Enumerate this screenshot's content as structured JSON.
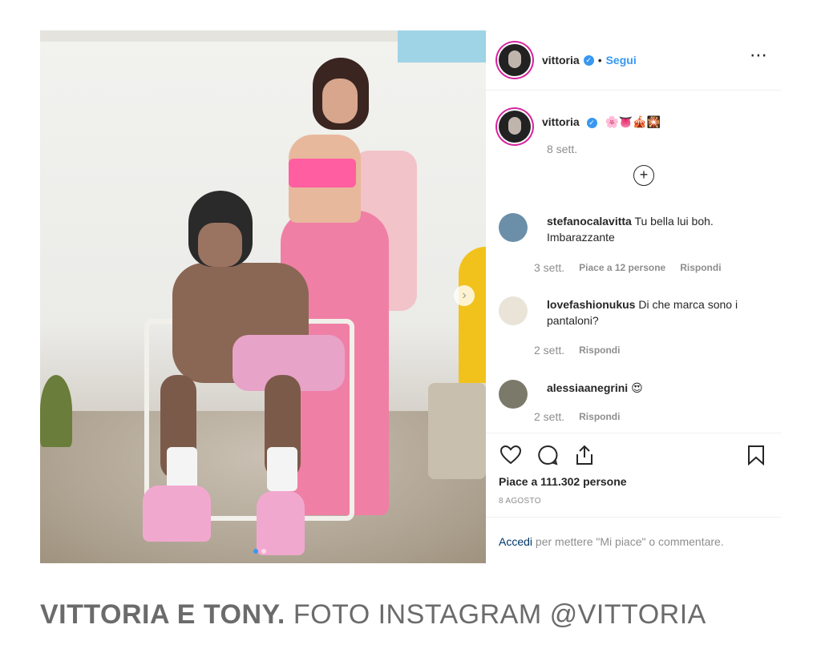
{
  "post": {
    "username": "vittoria",
    "verified_mark": "✓",
    "separator": "•",
    "follow_label": "Segui",
    "more_icon": "⋯",
    "caption_emojis": "🌸👅🎪🎇",
    "caption_time": "8 sett.",
    "expand_icon": "+",
    "next_icon": "›"
  },
  "comments": [
    {
      "user": "stefanocalavitta",
      "text": "Tu bella lui boh. Imbarazzante",
      "time": "3 sett.",
      "likes": "Piace a 12 persone",
      "reply": "Rispondi",
      "avatar_color": "#6b8fa8"
    },
    {
      "user": "lovefashionukus",
      "text": "Di che marca sono i pantaloni?",
      "time": "2 sett.",
      "reply": "Rispondi",
      "avatar_color": "#e9e3d8"
    },
    {
      "user": "alessiaanegrini",
      "text": "😍",
      "time": "2 sett.",
      "reply": "Rispondi",
      "avatar_color": "#7b7a6a"
    }
  ],
  "actions": {
    "likes": "Piace a 111.302 persone",
    "date": "8 AGOSTO",
    "login_link": "Accedi",
    "login_text": " per mettere \"Mi piace\" o commentare."
  },
  "footer": {
    "bold": "VITTORIA E TONY.",
    "rest": " FOTO INSTAGRAM @VITTORIA"
  },
  "colors": {
    "accent": "#3897f0",
    "story_ring": "#d6249f"
  }
}
